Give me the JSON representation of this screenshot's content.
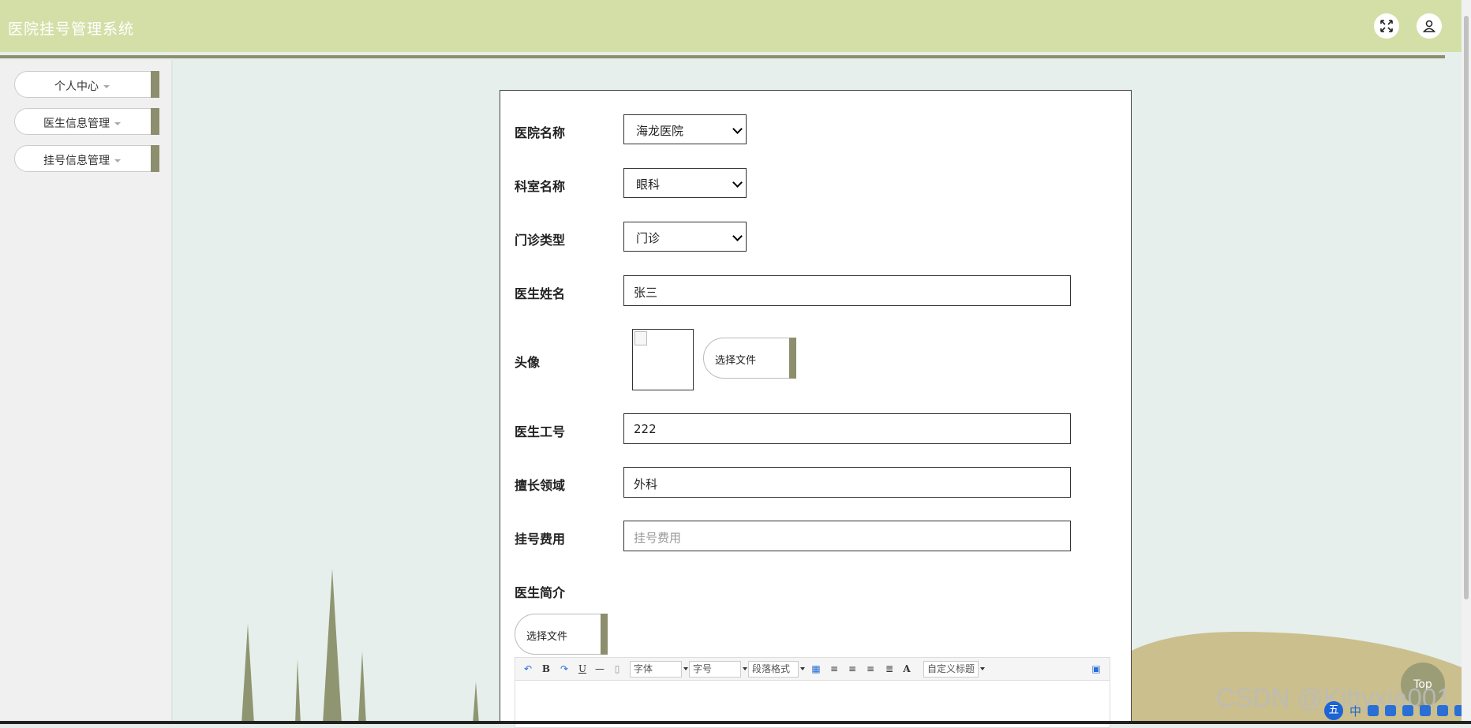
{
  "header": {
    "title": "医院挂号管理系统",
    "fullscreen_icon": "expand-icon",
    "user_icon": "user-icon",
    "background_color": "#d4dfa7"
  },
  "sidebar": {
    "items": [
      {
        "label": "个人中心"
      },
      {
        "label": "医生信息管理"
      },
      {
        "label": "挂号信息管理"
      }
    ]
  },
  "form": {
    "hospital": {
      "label": "医院名称",
      "value": "海龙医院"
    },
    "department": {
      "label": "科室名称",
      "value": "眼科"
    },
    "clinic_type": {
      "label": "门诊类型",
      "value": "门诊"
    },
    "doctor_name": {
      "label": "医生姓名",
      "value": "张三"
    },
    "avatar": {
      "label": "头像",
      "button_label": "选择文件"
    },
    "doctor_id": {
      "label": "医生工号",
      "value": "222"
    },
    "specialty": {
      "label": "擅长领域",
      "value": "外科"
    },
    "fee": {
      "label": "挂号费用",
      "value": "",
      "placeholder": "挂号费用"
    },
    "intro": {
      "label": "医生简介",
      "button_label": "选择文件"
    }
  },
  "editor_toolbar": {
    "font_family": "字体",
    "font_size": "字号",
    "paragraph": "段落格式",
    "custom_title": "自定义标题",
    "font_color_glyph": "A",
    "bold_glyph": "B",
    "underline_glyph": "U"
  },
  "top_button": {
    "label": "Top"
  },
  "watermark": "CSDN @Kittyxia001",
  "ime": {
    "label": "中"
  },
  "colors": {
    "accent": "#8c8e6e",
    "page_bg": "#e7efec",
    "hill": "#cbbf8d"
  }
}
